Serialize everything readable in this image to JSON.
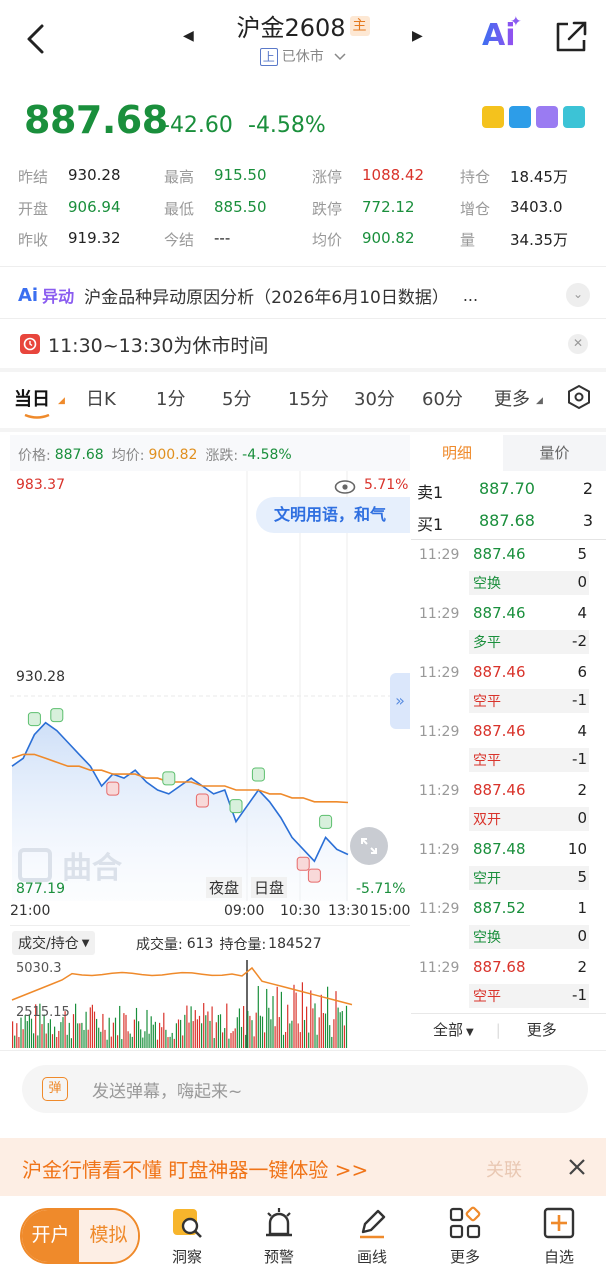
{
  "header": {
    "title": "沪金2608",
    "main_badge": "主",
    "exchange_badge": "上",
    "status": "已休市",
    "ai_label": "Ai"
  },
  "quote": {
    "price": "887.68",
    "change": "-42.60",
    "change_pct": "-4.58%"
  },
  "stats": [
    [
      {
        "label": "昨结",
        "value": "930.28",
        "color": "#222222"
      },
      {
        "label": "最高",
        "value": "915.50",
        "color": "#1a8f3c"
      },
      {
        "label": "涨停",
        "value": "1088.42",
        "color": "#d9332b"
      },
      {
        "label": "持仓",
        "value": "18.45万",
        "color": "#222222"
      }
    ],
    [
      {
        "label": "开盘",
        "value": "906.94",
        "color": "#1a8f3c"
      },
      {
        "label": "最低",
        "value": "885.50",
        "color": "#1a8f3c"
      },
      {
        "label": "跌停",
        "value": "772.12",
        "color": "#1a8f3c"
      },
      {
        "label": "增仓",
        "value": "3403.0",
        "color": "#222222"
      }
    ],
    [
      {
        "label": "昨收",
        "value": "919.32",
        "color": "#222222"
      },
      {
        "label": "今结",
        "value": "---",
        "color": "#222222"
      },
      {
        "label": "均价",
        "value": "900.82",
        "color": "#1a8f3c"
      },
      {
        "label": "量",
        "value": "34.35万",
        "color": "#222222"
      }
    ]
  ],
  "ai_banner": {
    "tag": "异动",
    "text": "沪金品种异动原因分析（2026年6月10日数据）",
    "more": "..."
  },
  "rest_banner": {
    "text": "11:30~13:30为休市时间"
  },
  "tabs": [
    "当日",
    "日K",
    "1分",
    "5分",
    "15分",
    "30分",
    "60分",
    "更多"
  ],
  "chart": {
    "price_label": "价格:",
    "price_value": "887.68",
    "avg_label": "均价:",
    "avg_value": "900.82",
    "chg_label": "涨跌:",
    "chg_value": "-4.58%",
    "y_top": "983.37",
    "y_mid": "930.28",
    "y_bot": "877.19",
    "pct_top": "5.71%",
    "pct_bot": "-5.71%",
    "bubble": "文明用语，和气",
    "watermark": "曲合",
    "session_night": "夜盘",
    "session_day": "日盘",
    "x_ticks": [
      "21:00",
      "09:00",
      "10:30",
      "13:30",
      "15:00"
    ],
    "indicator_select": "成交/持仓",
    "vol_label": "成交量:",
    "vol_value": "613",
    "oi_label": "持仓量:",
    "oi_value": "184527",
    "vol_top": "5030.3",
    "vol_mid": "2515.15"
  },
  "chart_data": {
    "type": "line",
    "title": "",
    "xlabel": "",
    "ylabel": "",
    "x_ticks": [
      "21:00",
      "09:00",
      "10:30",
      "13:30",
      "15:00"
    ],
    "ylim": [
      877.19,
      983.37
    ],
    "series": [
      {
        "name": "价格",
        "values": [
          910,
          912,
          918,
          921,
          919,
          916,
          913,
          910,
          905,
          908,
          907,
          909,
          906,
          904,
          903,
          905,
          907,
          905,
          903,
          904,
          896,
          900,
          904,
          901,
          897,
          892,
          889,
          886,
          892,
          889,
          887.68
        ]
      },
      {
        "name": "均价",
        "values": [
          912,
          913,
          913,
          912,
          911,
          910,
          910,
          909,
          909,
          908,
          908,
          908,
          907,
          907,
          906,
          906,
          906,
          905,
          905,
          905,
          904,
          904,
          904,
          903,
          903,
          902,
          902,
          901,
          901,
          901,
          900.82
        ]
      }
    ]
  },
  "detail_tabs": [
    "明细",
    "量价"
  ],
  "orderbook": [
    {
      "label": "卖1",
      "price": "887.70",
      "vol": "2"
    },
    {
      "label": "买1",
      "price": "887.68",
      "vol": "3"
    }
  ],
  "trades": [
    {
      "time": "11:29",
      "price": "887.46",
      "vol": "5",
      "type": "空换",
      "delta": "0",
      "color": "#1a8f3c"
    },
    {
      "time": "11:29",
      "price": "887.46",
      "vol": "4",
      "type": "多平",
      "delta": "-2",
      "color": "#1a8f3c"
    },
    {
      "time": "11:29",
      "price": "887.46",
      "vol": "6",
      "type": "空平",
      "delta": "-1",
      "color": "#d9332b"
    },
    {
      "time": "11:29",
      "price": "887.46",
      "vol": "4",
      "type": "空平",
      "delta": "-1",
      "color": "#d9332b"
    },
    {
      "time": "11:29",
      "price": "887.46",
      "vol": "2",
      "type": "双开",
      "delta": "0",
      "color": "#d9332b"
    },
    {
      "time": "11:29",
      "price": "887.48",
      "vol": "10",
      "type": "空开",
      "delta": "5",
      "color": "#1a8f3c"
    },
    {
      "time": "11:29",
      "price": "887.52",
      "vol": "1",
      "type": "空换",
      "delta": "0",
      "color": "#1a8f3c"
    },
    {
      "time": "11:29",
      "price": "887.68",
      "vol": "2",
      "type": "空平",
      "delta": "-1",
      "color": "#d9332b"
    }
  ],
  "trade_footer": {
    "all": "全部",
    "more": "更多"
  },
  "danmu": {
    "badge": "弹",
    "placeholder": "发送弹幕，嗨起来~"
  },
  "promo": {
    "text": "沪金行情看不懂  盯盘神器一键体验 >>",
    "ghost": "关联"
  },
  "bottom_nav": {
    "open": "开户",
    "sim": "模拟",
    "items": [
      "洞察",
      "预警",
      "画线",
      "更多",
      "自选"
    ]
  },
  "colors": {
    "green": "#1a8f3c",
    "red": "#d9332b",
    "orange": "#ef8a2b",
    "accent_blue": "#2f6fe0"
  }
}
